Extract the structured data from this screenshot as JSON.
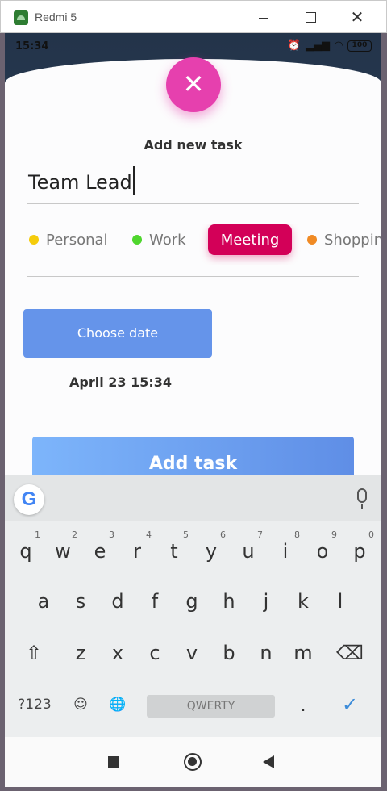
{
  "window": {
    "title": "Redmi 5"
  },
  "statusbar": {
    "time": "15:34",
    "battery": "100"
  },
  "sheet": {
    "close_symbol": "✕",
    "title": "Add new task",
    "task_value": "Team Lead",
    "categories": [
      {
        "label": "Personal",
        "color": "#f5cc0c",
        "selected": false
      },
      {
        "label": "Work",
        "color": "#4fd62e",
        "selected": false
      },
      {
        "label": "Meeting",
        "color": "#d30058",
        "selected": true
      },
      {
        "label": "Shopping",
        "color": "#f08a24",
        "selected": false
      }
    ],
    "choose_date_label": "Choose date",
    "date_value": "April 23 15:34",
    "add_task_label": "Add task"
  },
  "keyboard": {
    "google_logo": "G",
    "row1": [
      {
        "key": "q",
        "hint": "1"
      },
      {
        "key": "w",
        "hint": "2"
      },
      {
        "key": "e",
        "hint": "3"
      },
      {
        "key": "r",
        "hint": "4"
      },
      {
        "key": "t",
        "hint": "5"
      },
      {
        "key": "y",
        "hint": "6"
      },
      {
        "key": "u",
        "hint": "7"
      },
      {
        "key": "i",
        "hint": "8"
      },
      {
        "key": "o",
        "hint": "9"
      },
      {
        "key": "p",
        "hint": "0"
      }
    ],
    "row2": [
      "a",
      "s",
      "d",
      "f",
      "g",
      "h",
      "j",
      "k",
      "l"
    ],
    "row3": [
      "z",
      "x",
      "c",
      "v",
      "b",
      "n",
      "m"
    ],
    "shift": "⇧",
    "backspace": "⌫",
    "symbols_label": "?123",
    "emoji": "☺",
    "globe": "🌐",
    "space_label": "QWERTY",
    "period": ".",
    "enter": "✓"
  },
  "accent_colors": {
    "fab": "#e640ae",
    "primary_button": "#6594ea",
    "selected_category": "#d30058"
  }
}
